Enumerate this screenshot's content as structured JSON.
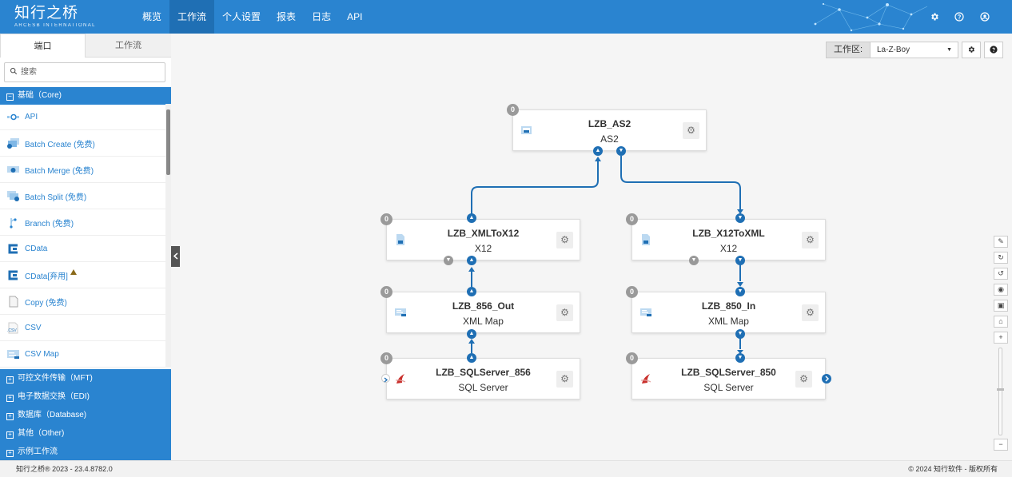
{
  "header": {
    "brand_name": "知行之桥",
    "brand_sub": "ARCESB INTERNATIONAL",
    "nav": [
      "概览",
      "工作流",
      "个人设置",
      "报表",
      "日志",
      "API"
    ],
    "active_nav": 1,
    "icons": [
      "gear-icon",
      "help-icon",
      "user-icon"
    ],
    "colors": {
      "primary": "#2a84d0",
      "active": "#1f6fb4"
    }
  },
  "sidebar": {
    "tabs": [
      "端口",
      "工作流"
    ],
    "search_placeholder": "搜索",
    "core_category": "基础（Core)",
    "components": [
      {
        "label": "API",
        "icon": "api-icon"
      },
      {
        "label": "Batch Create (免费)",
        "icon": "batch-create-icon"
      },
      {
        "label": "Batch Merge (免费)",
        "icon": "batch-merge-icon"
      },
      {
        "label": "Batch Split (免费)",
        "icon": "batch-split-icon"
      },
      {
        "label": "Branch (免费)",
        "icon": "branch-icon"
      },
      {
        "label": "CData",
        "icon": "cdata-icon"
      },
      {
        "label": "CData[弃用]",
        "icon": "cdata-deprecated-icon"
      },
      {
        "label": "Copy (免费)",
        "icon": "copy-icon"
      },
      {
        "label": "CSV",
        "icon": "csv-icon"
      },
      {
        "label": "CSV Map",
        "icon": "csv-map-icon"
      }
    ],
    "categories": [
      "可控文件传输（MFT)",
      "电子数据交换（EDI)",
      "数据库（Database)",
      "其他（Other)",
      "示例工作流"
    ]
  },
  "workspace": {
    "label": "工作区:",
    "selected": "La-Z-Boy"
  },
  "nodes": [
    {
      "title": "LZB_AS2",
      "sub": "AS2",
      "badge": "0"
    },
    {
      "title": "LZB_XMLToX12",
      "sub": "X12",
      "badge": "0"
    },
    {
      "title": "LZB_X12ToXML",
      "sub": "X12",
      "badge": "0"
    },
    {
      "title": "LZB_856_Out",
      "sub": "XML Map",
      "badge": "0"
    },
    {
      "title": "LZB_850_In",
      "sub": "XML Map",
      "badge": "0"
    },
    {
      "title": "LZB_SQLServer_856",
      "sub": "SQL Server",
      "badge": "0"
    },
    {
      "title": "LZB_SQLServer_850",
      "sub": "SQL Server",
      "badge": "0"
    }
  ],
  "footer": {
    "left": "知行之桥® 2023 - 23.4.8782.0",
    "right": "© 2024 知行软件 - 版权所有"
  }
}
